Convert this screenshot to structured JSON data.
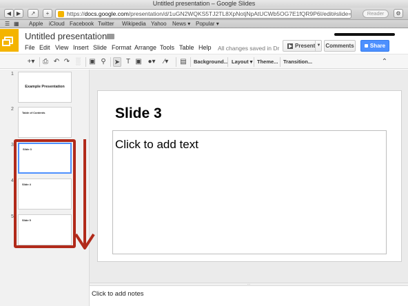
{
  "browser": {
    "window_title": "Untitled presentation – Google Slides",
    "url_scheme": "https",
    "url_host": "docs.google.com",
    "url_path": "/presentation/d/1uGN2WQKS5TJ2TL8XpNotjNpAtUCWb5OG7E1fQR9P6I/edit#slide=id.g5a4d…",
    "reader_label": "Reader",
    "bookmarks": [
      "Apple",
      "iCloud",
      "Facebook",
      "Twitter",
      "Wikipedia",
      "Yahoo",
      "News ▾",
      "Popular ▾"
    ]
  },
  "docs": {
    "title": "Untitled presentation",
    "menu": [
      "File",
      "Edit",
      "View",
      "Insert",
      "Slide",
      "Format",
      "Arrange",
      "Tools",
      "Table",
      "Help"
    ],
    "save_status": "All changes saved in Dr…",
    "present_label": "Present",
    "comments_label": "Comments",
    "share_label": "Share",
    "brand_color": "#f4b400",
    "share_color": "#4d90fe"
  },
  "toolbar": {
    "background_label": "Background...",
    "layout_label": "Layout ▾",
    "theme_label": "Theme...",
    "transition_label": "Transition..."
  },
  "slides": [
    {
      "number": "1",
      "title": "Example Presentation"
    },
    {
      "number": "2",
      "title": "Table of Contents"
    },
    {
      "number": "3",
      "title": "Slide 3"
    },
    {
      "number": "4",
      "title": "Slide 4"
    },
    {
      "number": "5",
      "title": "Slide 5"
    }
  ],
  "active_slide": {
    "title": "Slide 3",
    "body_placeholder": "Click to add text"
  },
  "notes_placeholder": "Click to add notes",
  "annotation_color": "#b12a1a"
}
